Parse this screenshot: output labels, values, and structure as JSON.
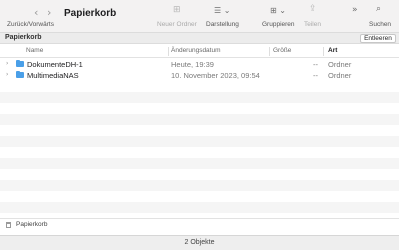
{
  "window": {
    "title": "Papierkorb"
  },
  "toolbar": {
    "back_icon": "chevron-left-icon",
    "forward_icon": "chevron-right-icon",
    "nav_label": "Zurück/Vorwärts",
    "new_folder_label": "Neuer Ordner",
    "view_label": "Darstellung",
    "group_label": "Gruppieren",
    "share_label": "Teilen",
    "search_label": "Suchen",
    "more_icon": "double-chevron-right-icon"
  },
  "pathbar": {
    "title": "Papierkorb",
    "empty_button": "Entleeren"
  },
  "columns": {
    "name": "Name",
    "date": "Änderungsdatum",
    "size": "Größe",
    "kind": "Art"
  },
  "files": [
    {
      "name": "DokumenteDH-1",
      "date": "Heute, 19:39",
      "size": "--",
      "kind": "Ordner"
    },
    {
      "name": "MultimediaNAS",
      "date": "10. November 2023, 09:54",
      "size": "--",
      "kind": "Ordner"
    }
  ],
  "footer": {
    "path_label": "Papierkorb"
  },
  "status": {
    "count_text": "2 Objekte"
  },
  "colors": {
    "folder": "#4a9fe8",
    "toolbar_bg": "#f3f2f2",
    "row_alt": "#f5f5f5"
  }
}
